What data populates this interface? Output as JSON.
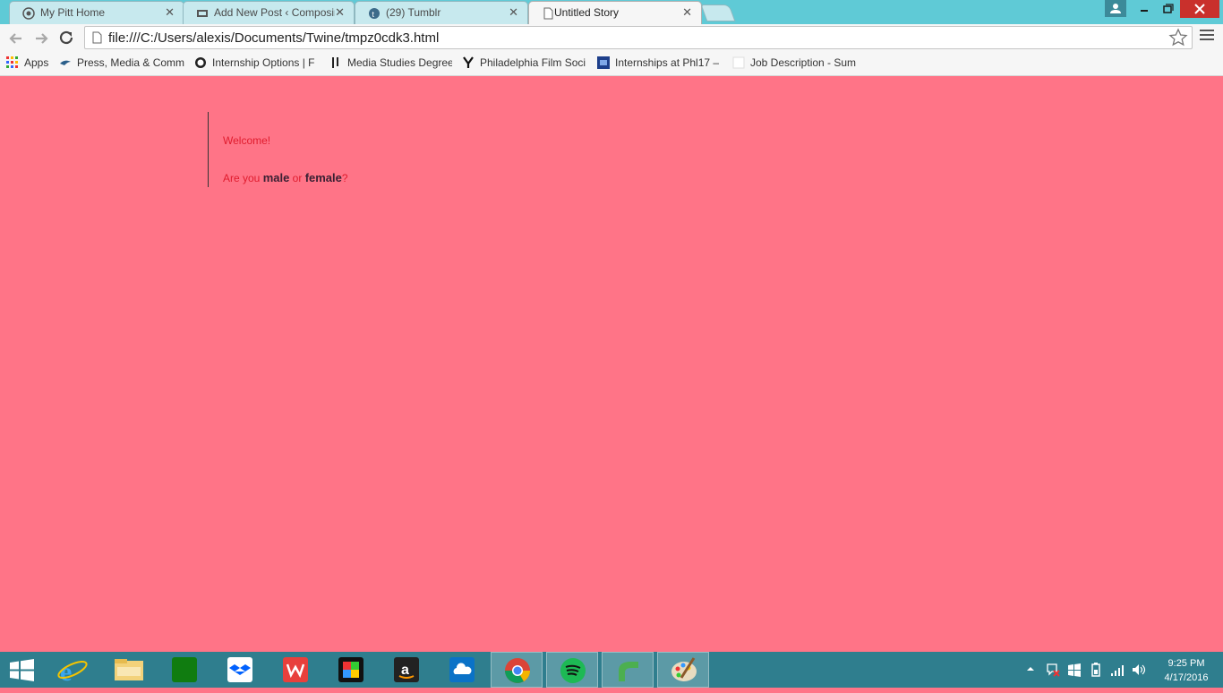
{
  "tabs": [
    {
      "title": "My Pitt Home",
      "icon": "pitt-icon"
    },
    {
      "title": "Add New Post ‹ Composin",
      "icon": "wordpress-icon"
    },
    {
      "title": "(29) Tumblr",
      "icon": "tumblr-icon"
    },
    {
      "title": "Untitled Story",
      "icon": "page-icon",
      "active": true
    }
  ],
  "tab_close": "✕",
  "address": {
    "url": "file:///C:/Users/alexis/Documents/Twine/tmpz0cdk3.html"
  },
  "bookmarks": [
    {
      "label": "Apps"
    },
    {
      "label": "Press, Media & Comm"
    },
    {
      "label": "Internship Options | F"
    },
    {
      "label": "Media Studies Degree"
    },
    {
      "label": "Philadelphia Film Soci"
    },
    {
      "label": "Internships at Phl17 –"
    },
    {
      "label": "Job Description - Sum"
    }
  ],
  "story": {
    "welcome": "Welcome!",
    "q_prefix": "Are you ",
    "link_male": "male",
    "q_or": " or ",
    "link_female": "female",
    "q_suffix": "?"
  },
  "clock": {
    "time": "9:25 PM",
    "date": "4/17/2016"
  },
  "colors": {
    "page_bg": "#ff7487",
    "text": "#e01c2e",
    "link": "#3a2033",
    "taskbar": "#2f7e8e"
  }
}
